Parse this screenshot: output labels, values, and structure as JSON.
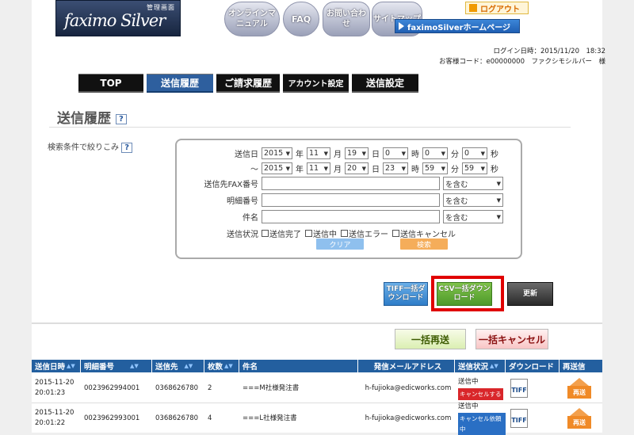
{
  "header": {
    "logo_sub": "管理画面",
    "logo_main": "faximo Silver",
    "nav": [
      "オンラインマニュアル",
      "FAQ",
      "お問い合わせ",
      "サイトマップ"
    ],
    "logout": "ログアウト",
    "homepage": "faximoSilverホームページ",
    "login_time": "ログイン日時：2015/11/20　18:32",
    "customer": "お客様コード：e00000000　ファクシモシルバー　様"
  },
  "tabs": [
    "TOP",
    "送信履歴",
    "ご請求履歴",
    "アカウント設定",
    "送信設定"
  ],
  "page_title": "送信履歴",
  "filter_label": "検索条件で絞りこみ",
  "search": {
    "send_date_label": "送信日",
    "tilde": "〜",
    "from": {
      "year": "2015",
      "month": "11",
      "day": "19",
      "hour": "0",
      "min": "0",
      "sec": "0"
    },
    "to": {
      "year": "2015",
      "month": "11",
      "day": "20",
      "hour": "23",
      "min": "59",
      "sec": "59"
    },
    "units": {
      "year": "年",
      "month": "月",
      "day": "日",
      "hour": "時",
      "min": "分",
      "sec": "秒"
    },
    "fax_label": "送信先FAX番号",
    "detail_label": "明細番号",
    "subject_label": "件名",
    "contains": "を含む",
    "status_label": "送信状況",
    "statuses": [
      "送信完了",
      "送信中",
      "送信エラー",
      "送信キャンセル"
    ],
    "clear": "クリア",
    "search": "検索"
  },
  "actions": {
    "tiff_dl": "TIFF一括ダウンロード",
    "csv_dl": "CSV一括ダウンロード",
    "refresh": "更新",
    "bulk_resend": "一括再送",
    "bulk_cancel": "一括キャンセル"
  },
  "table": {
    "headers": [
      "送信日時",
      "明細番号",
      "送信先",
      "枚数",
      "件名",
      "発信メールアドレス",
      "送信状況",
      "ダウンロード",
      "再送信"
    ],
    "rows": [
      {
        "date": "2015-11-20",
        "time": "20:01:23",
        "detail": "0023962994001",
        "dest": "0368626780",
        "pages": "2",
        "subject": "===M社様発注書",
        "email": "h-fujioka@edicworks.com",
        "status": "送信中",
        "badge": "キャンセルする",
        "tiff": "TIFF",
        "resend": "再送"
      },
      {
        "date": "2015-11-20",
        "time": "20:01:22",
        "detail": "0023962993001",
        "dest": "0368626780",
        "pages": "4",
        "subject": "===L社様発注書",
        "email": "h-fujioka@edicworks.com",
        "status": "送信中",
        "badge": "キャンセル依頼中",
        "tiff": "TIFF",
        "resend": "再送"
      }
    ]
  },
  "colors": {
    "header_blue": "#235f9f",
    "tab_active": "#2e5f9e",
    "highlight": "#e00000",
    "csv_green": "#4e9a2a",
    "tiff_blue": "#3f8fd6"
  }
}
